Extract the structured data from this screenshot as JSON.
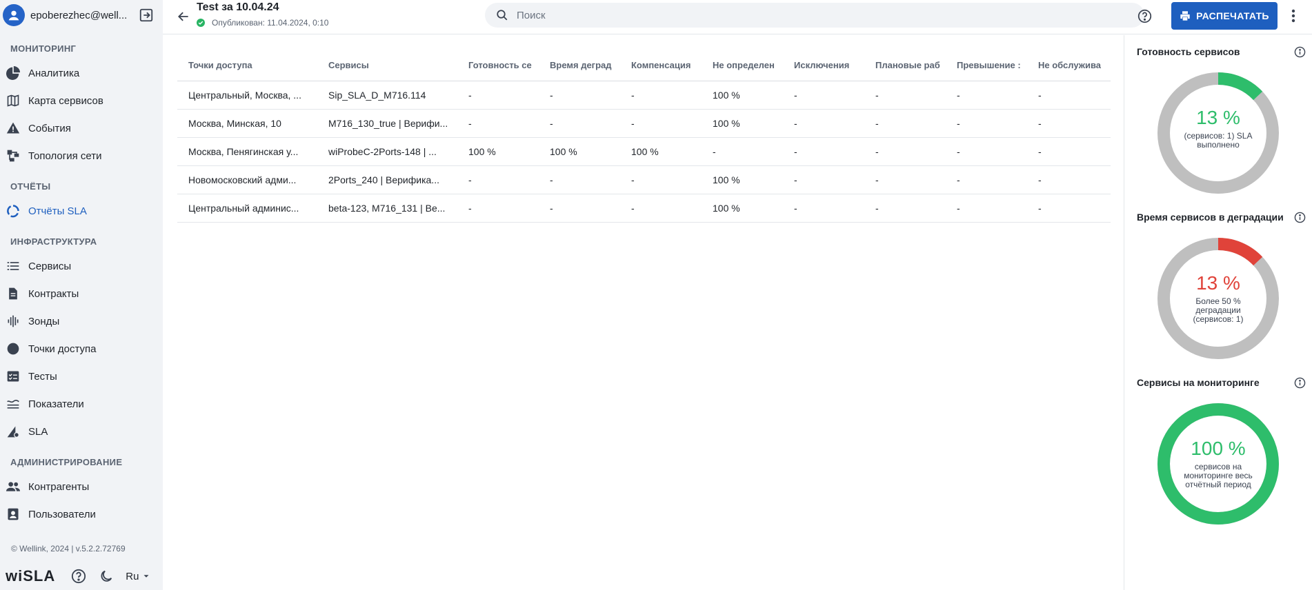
{
  "user": {
    "name": "epoberezhec@well..."
  },
  "sidebar": {
    "sections": [
      {
        "title": "МОНИТОРИНГ",
        "items": [
          {
            "label": "Аналитика",
            "icon": "pie-chart-icon"
          },
          {
            "label": "Карта сервисов",
            "icon": "map-icon"
          },
          {
            "label": "События",
            "icon": "warning-icon"
          },
          {
            "label": "Топология сети",
            "icon": "topology-icon"
          }
        ]
      },
      {
        "title": "ОТЧЁТЫ",
        "items": [
          {
            "label": "Отчёты SLA",
            "icon": "report-sla-icon",
            "active": true
          }
        ]
      },
      {
        "title": "ИНФРАСТРУКТУРА",
        "items": [
          {
            "label": "Сервисы",
            "icon": "list-icon"
          },
          {
            "label": "Контракты",
            "icon": "document-icon"
          },
          {
            "label": "Зонды",
            "icon": "probe-icon"
          },
          {
            "label": "Точки доступа",
            "icon": "access-point-icon"
          },
          {
            "label": "Тесты",
            "icon": "checklist-icon"
          },
          {
            "label": "Показатели",
            "icon": "metrics-icon"
          },
          {
            "label": "SLA",
            "icon": "sla-settings-icon"
          }
        ]
      },
      {
        "title": "АДМИНИСТРИРОВАНИЕ",
        "items": [
          {
            "label": "Контрагенты",
            "icon": "people-icon"
          },
          {
            "label": "Пользователи",
            "icon": "user-card-icon"
          }
        ]
      }
    ],
    "copyright": "© Wellink, 2024 | v.5.2.2.72769",
    "logo": "wiSLA",
    "language": "Ru"
  },
  "header": {
    "title": "Test за 10.04.24",
    "status": "Опубликован: 11.04.2024, 0:10",
    "search_placeholder": "Поиск",
    "print_label": "РАСПЕЧАТАТЬ"
  },
  "table": {
    "columns": [
      "Точки доступа",
      "Сервисы",
      "Готовность се",
      "Время деград",
      "Компенсация",
      "Не определен",
      "Исключения",
      "Плановые раб",
      "Превышение :",
      "Не обслужива"
    ],
    "rows": [
      [
        "Центральный, Москва, ...",
        "Sip_SLA_D_M716.114",
        "-",
        "-",
        "-",
        "100 %",
        "-",
        "-",
        "-",
        "-"
      ],
      [
        "Москва, Минская, 10",
        "M716_130_true | Верифи...",
        "-",
        "-",
        "-",
        "100 %",
        "-",
        "-",
        "-",
        "-"
      ],
      [
        "Москва, Пенягинская у...",
        "wiProbeC-2Ports-148 | ...",
        "100 %",
        "100 %",
        "100 %",
        "-",
        "-",
        "-",
        "-",
        "-"
      ],
      [
        "Новомосковский адми...",
        "2Ports_240 | Верифика...",
        "-",
        "-",
        "-",
        "100 %",
        "-",
        "-",
        "-",
        "-"
      ],
      [
        "Центральный админис...",
        "beta-123, M716_131 | Be...",
        "-",
        "-",
        "-",
        "100 %",
        "-",
        "-",
        "-",
        "-"
      ]
    ]
  },
  "panel": {
    "cards": [
      {
        "title": "Готовность сервисов",
        "percent_label": "13 %",
        "fraction": 0.13,
        "color": "#2ebd6b",
        "desc_lines": [
          "(сервисов: 1) SLA",
          "выполнено"
        ]
      },
      {
        "title": "Время сервисов в деградации",
        "percent_label": "13 %",
        "fraction": 0.13,
        "color": "#e0433a",
        "desc_lines": [
          "Более 50 %",
          "деградации",
          "(сервисов: 1)"
        ]
      },
      {
        "title": "Сервисы на мониторинге",
        "percent_label": "100 %",
        "fraction": 1.0,
        "color": "#2ebd6b",
        "desc_lines": [
          "сервисов на",
          "мониторинге весь",
          "отчётный период"
        ]
      }
    ],
    "track_color": "#bfbfbf"
  }
}
